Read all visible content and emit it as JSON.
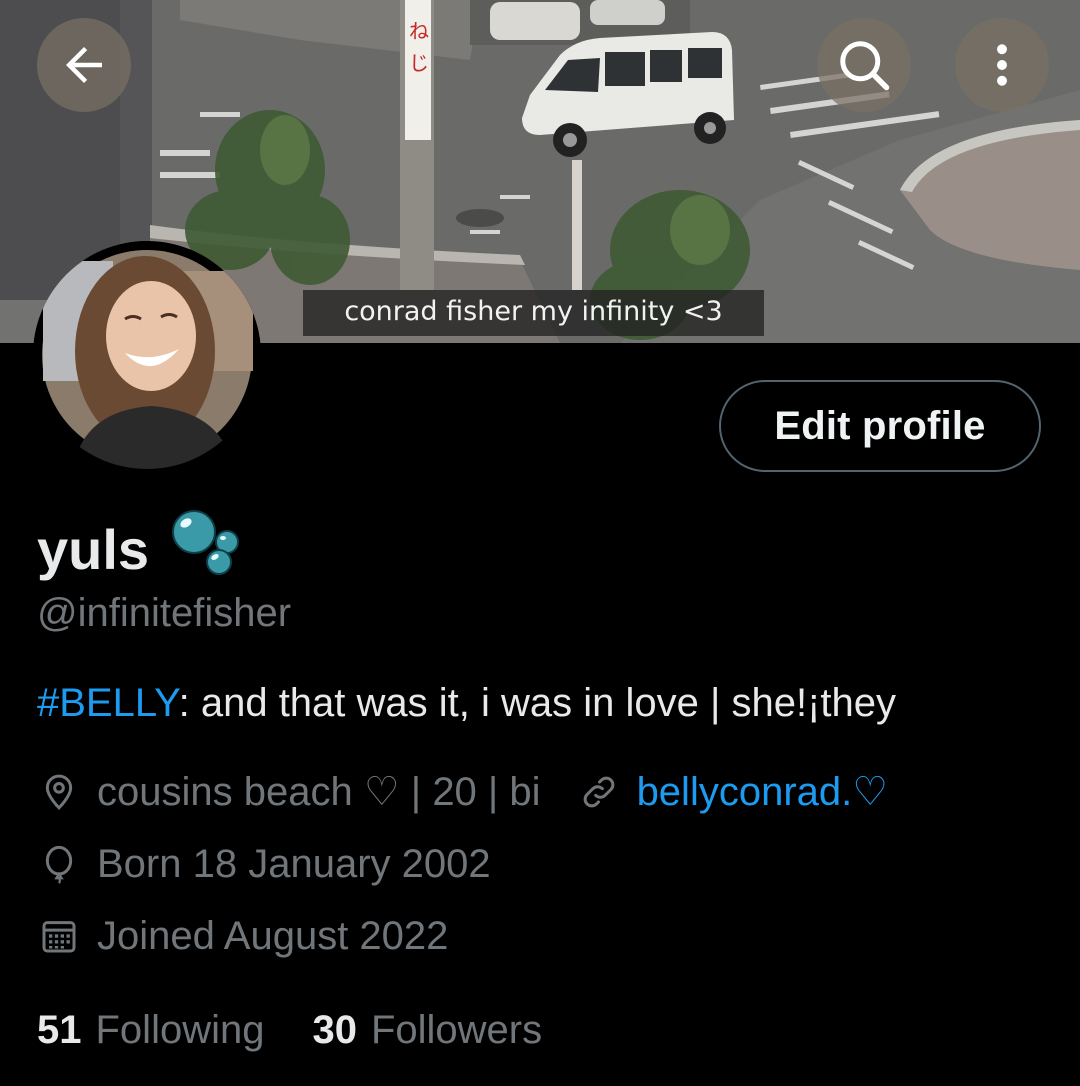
{
  "banner": {
    "caption": "conrad fisher my infinity <3",
    "sign_text": "ねじ"
  },
  "header_buttons": {
    "back_icon": "arrow-left-icon",
    "search_icon": "search-icon",
    "more_icon": "more-vertical-icon"
  },
  "profile": {
    "display_name": "yuls",
    "name_emoji": "bubbles",
    "handle": "@infinitefisher",
    "edit_button_label": "Edit profile",
    "bio_hashtag": "#BELLY",
    "bio_rest": ": and that was it, i was in love | she!¡they",
    "location": "cousins beach ♡ | 20 | bi",
    "link": "bellyconrad.♡",
    "birthday": "Born 18 January 2002",
    "joined": "Joined August 2022"
  },
  "stats": {
    "following_count": "51",
    "following_label": "Following",
    "followers_count": "30",
    "followers_label": "Followers"
  },
  "colors": {
    "background": "#000000",
    "text_primary": "#e7e9ea",
    "text_secondary": "#71767b",
    "accent": "#1d9bf0",
    "border": "#536471"
  }
}
